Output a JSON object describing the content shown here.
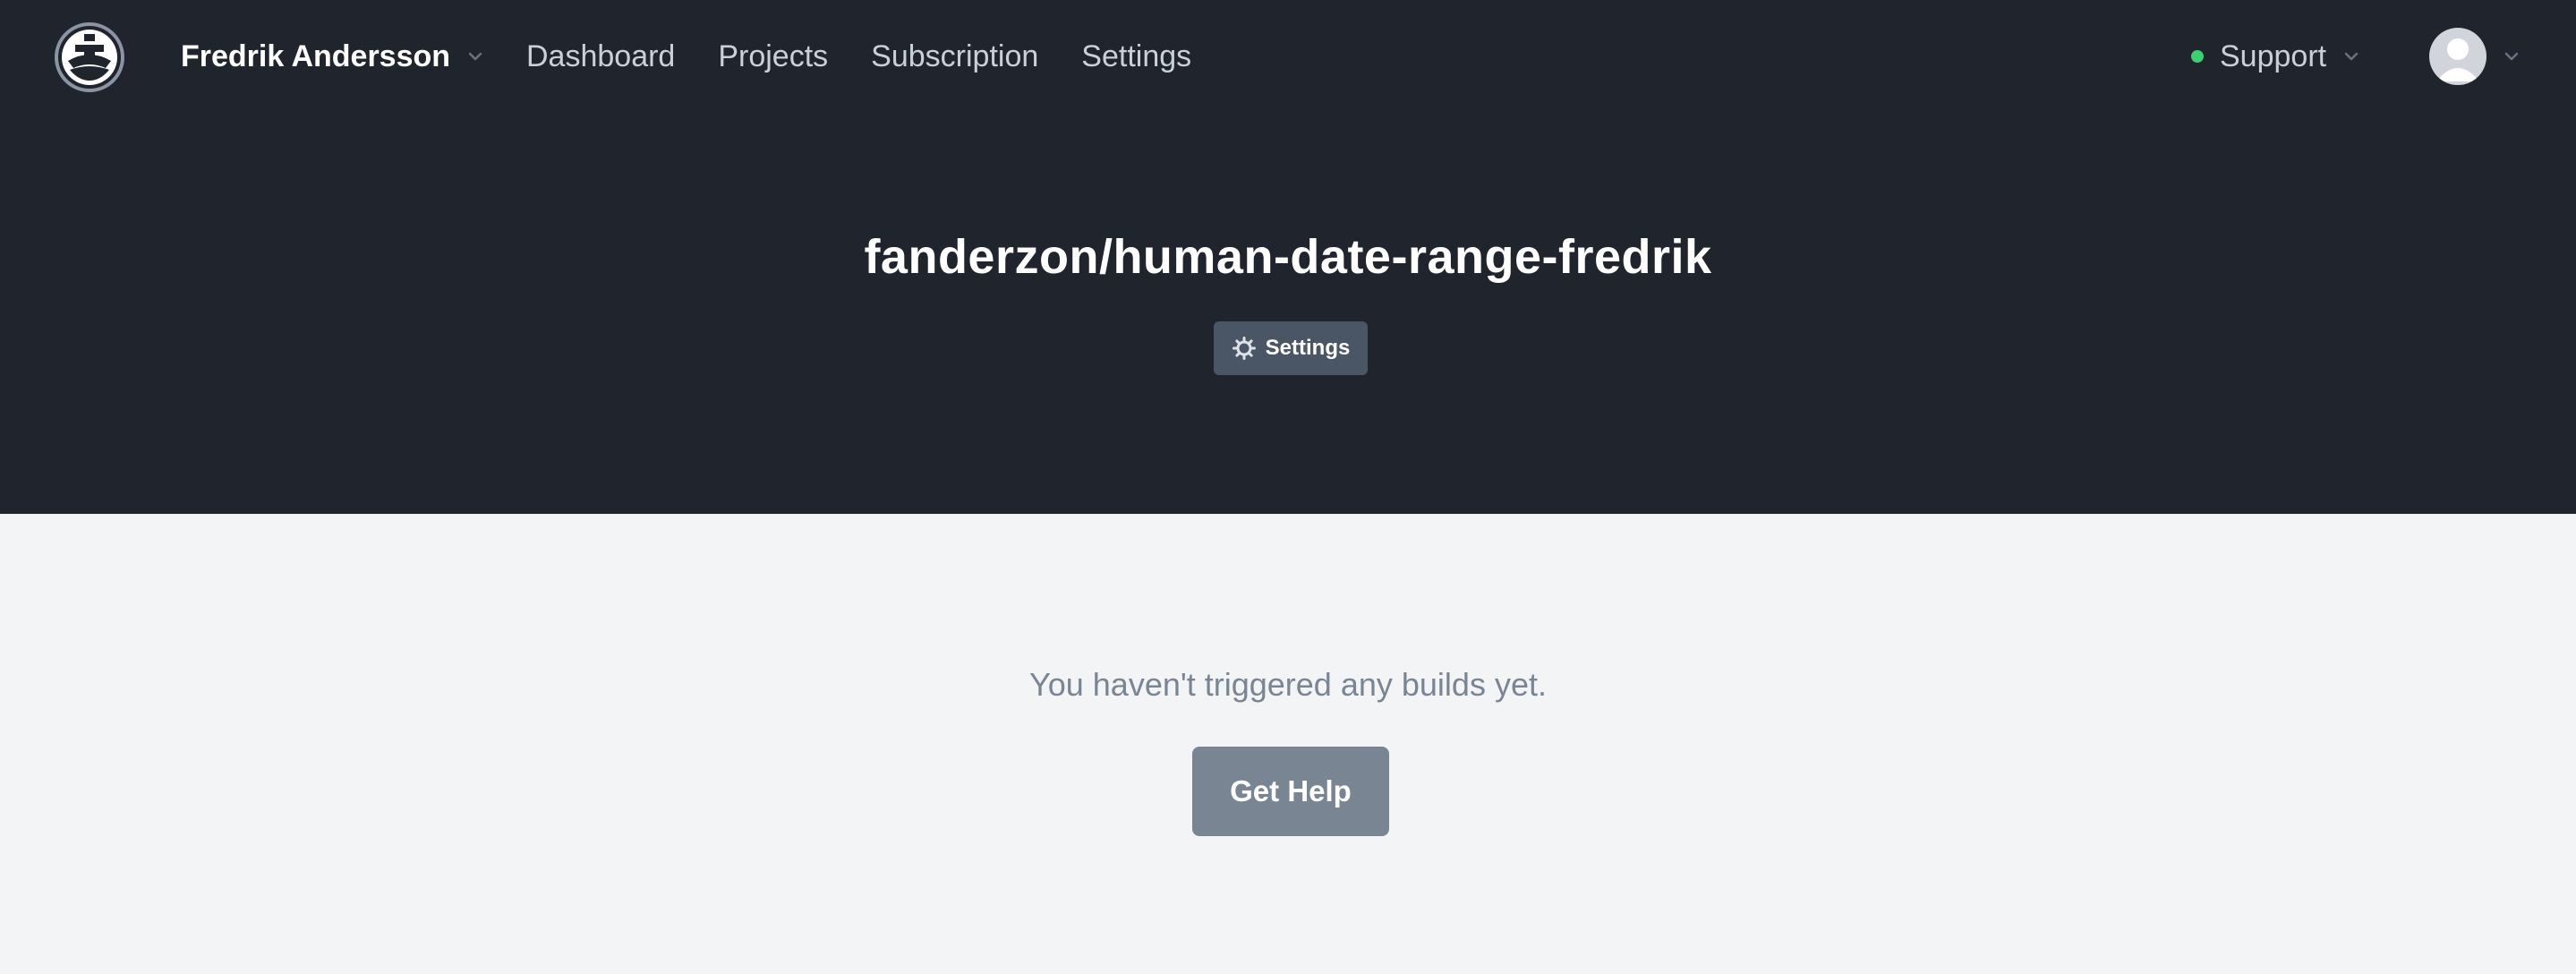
{
  "nav": {
    "account_name": "Fredrik Andersson",
    "links": [
      {
        "label": "Dashboard"
      },
      {
        "label": "Projects"
      },
      {
        "label": "Subscription"
      },
      {
        "label": "Settings"
      }
    ],
    "support_label": "Support",
    "support_status_color": "#3ecf6e"
  },
  "project": {
    "title": "fanderzon/human-date-range-fredrik",
    "settings_label": "Settings"
  },
  "main": {
    "empty_message": "You haven't triggered any builds yet.",
    "help_label": "Get Help"
  },
  "icons": {
    "logo": "ship-logo-icon",
    "chevron": "chevron-down-icon",
    "gear": "gear-icon",
    "avatar": "user-avatar-icon"
  },
  "colors": {
    "header_bg": "#20252d",
    "page_bg": "#f3f4f6",
    "settings_button_bg": "#4a5566",
    "help_button_bg": "#7a8594"
  }
}
